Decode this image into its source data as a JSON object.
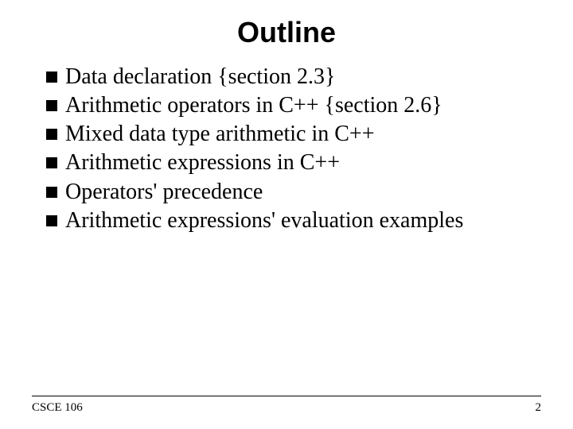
{
  "title": "Outline",
  "bullets": [
    {
      "text": "Data declaration {section 2.3}",
      "justify": false
    },
    {
      "text": "Arithmetic operators in C++ {section 2.6}",
      "justify": true
    },
    {
      "text": "Mixed data type arithmetic in C++",
      "justify": false
    },
    {
      "text": "Arithmetic expressions in C++",
      "justify": false
    },
    {
      "text": "Operators' precedence",
      "justify": false
    },
    {
      "text": "Arithmetic expressions' evaluation examples",
      "justify": false
    }
  ],
  "footer": {
    "left": "CSCE 106",
    "right": "2"
  }
}
